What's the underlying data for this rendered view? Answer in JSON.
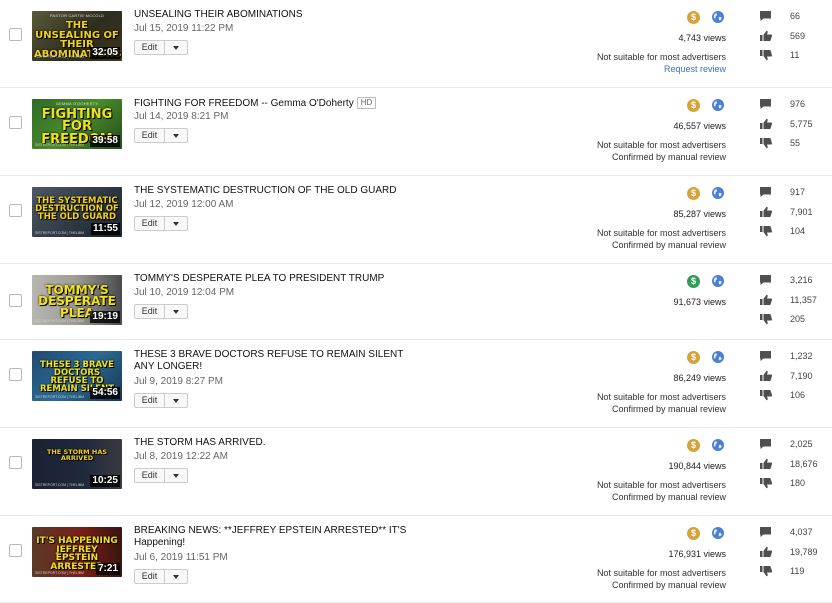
{
  "icons": {
    "coin_gold": "#d6a33b",
    "coin_green": "#2e9f52",
    "globe": "#4a7fd8",
    "comment_icon": "comment-icon",
    "like_icon": "thumbs-up-icon",
    "dislike_icon": "thumbs-down-icon"
  },
  "edit_label": "Edit",
  "videos": [
    {
      "title": "UNSEALING THEIR ABOMINATIONS",
      "hd": null,
      "date": "Jul 15, 2019 11:22 PM",
      "duration": "32:05",
      "thumb_pre": "PASTOR CARTIE MCCOLD",
      "thumb_text": "THE UNSEALING OF THEIR ABOMINATIONS",
      "thumb_foot": "SISTREPORT.COM | THELIBM",
      "monetization": "gold",
      "views": "4,743 views",
      "status": [
        "Not suitable for most advertisers"
      ],
      "review_link": "Request review",
      "comments": "66",
      "likes": "569",
      "dislikes": "11"
    },
    {
      "title": "FIGHTING FOR FREEDOM -- Gemma O'Doherty",
      "hd": "HD",
      "date": "Jul 14, 2019 8:21 PM",
      "duration": "39:58",
      "thumb_pre": "GEMMA O'DOHERTY",
      "thumb_text": "FIGHTING FOR FREEDOM",
      "thumb_foot": "SISTREPORT.COM | THELIBM",
      "monetization": "gold",
      "views": "46,557 views",
      "status": [
        "Not suitable for most advertisers",
        "Confirmed by manual review"
      ],
      "review_link": null,
      "comments": "976",
      "likes": "5,775",
      "dislikes": "55"
    },
    {
      "title": "THE SYSTEMATIC DESTRUCTION OF THE OLD GUARD",
      "hd": null,
      "date": "Jul 12, 2019 12:00 AM",
      "duration": "11:55",
      "thumb_pre": "",
      "thumb_text": "THE SYSTEMATIC DESTRUCTION OF THE OLD GUARD",
      "thumb_foot": "SISTREPORT.COM | THELIBM",
      "monetization": "gold",
      "views": "85,287 views",
      "status": [
        "Not suitable for most advertisers",
        "Confirmed by manual review"
      ],
      "review_link": null,
      "comments": "917",
      "likes": "7,901",
      "dislikes": "104"
    },
    {
      "title": "TOMMY'S DESPERATE PLEA TO PRESIDENT TRUMP",
      "hd": null,
      "date": "Jul 10, 2019 12:04 PM",
      "duration": "19:19",
      "thumb_pre": "",
      "thumb_text": "TOMMY'S DESPERATE PLEA",
      "thumb_foot": "SISTREPORT.COM | THELIBM",
      "monetization": "green",
      "views": "91,673 views",
      "status": [],
      "review_link": null,
      "comments": "3,216",
      "likes": "11,357",
      "dislikes": "205"
    },
    {
      "title": "THESE 3 BRAVE DOCTORS REFUSE TO REMAIN SILENT ANY LONGER!",
      "hd": null,
      "date": "Jul 9, 2019 8:27 PM",
      "duration": "54:56",
      "thumb_pre": "",
      "thumb_text": "THESE 3 BRAVE DOCTORS REFUSE TO REMAIN SILENT",
      "thumb_foot": "SISTREPORT.COM | THELIBM",
      "monetization": "gold",
      "views": "86,249 views",
      "status": [
        "Not suitable for most advertisers",
        "Confirmed by manual review"
      ],
      "review_link": null,
      "comments": "1,232",
      "likes": "7,190",
      "dislikes": "106"
    },
    {
      "title": "THE STORM HAS ARRIVED.",
      "hd": null,
      "date": "Jul 8, 2019 12:22 AM",
      "duration": "10:25",
      "thumb_pre": "",
      "thumb_text": "THE STORM HAS ARRIVED",
      "thumb_foot": "SISTREPORT.COM | THELIBM",
      "monetization": "gold",
      "views": "190,844 views",
      "status": [
        "Not suitable for most advertisers",
        "Confirmed by manual review"
      ],
      "review_link": null,
      "comments": "2,025",
      "likes": "18,676",
      "dislikes": "180"
    },
    {
      "title": "BREAKING NEWS: **JEFFREY EPSTEIN ARRESTED** IT'S Happening!",
      "hd": null,
      "date": "Jul 6, 2019 11:51 PM",
      "duration": "7:21",
      "thumb_pre": "",
      "thumb_text": "IT'S HAPPENING JEFFREY EPSTEIN ARRESTED",
      "thumb_foot": "SISTREPORT.COM | THELIBM",
      "monetization": "gold",
      "views": "176,931 views",
      "status": [
        "Not suitable for most advertisers",
        "Confirmed by manual review"
      ],
      "review_link": null,
      "comments": "4,037",
      "likes": "19,789",
      "dislikes": "119"
    }
  ]
}
